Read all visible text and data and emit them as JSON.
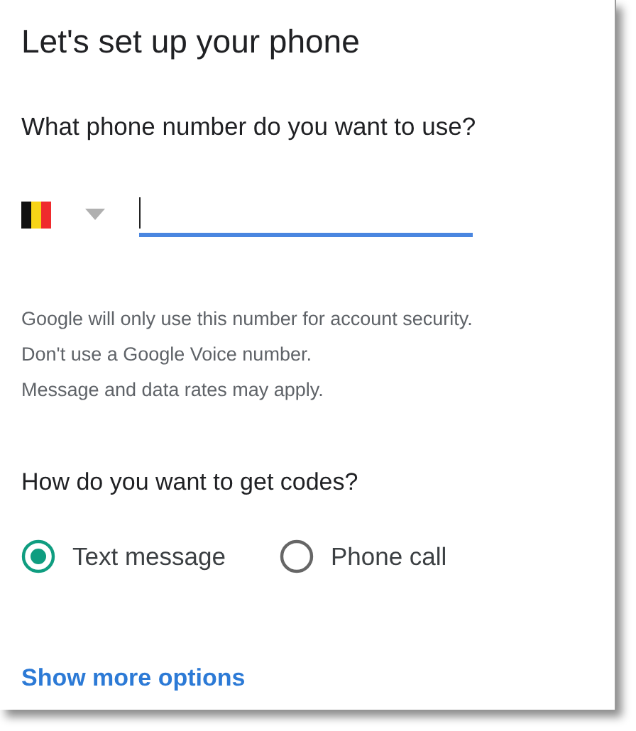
{
  "title": "Let's set up your phone",
  "phone_question": "What phone number do you want to use?",
  "phone_field": {
    "focused": true
  },
  "notes": [
    "Google will only use this number for account security.",
    "Don't use a Google Voice number.",
    "Message and data rates may apply."
  ],
  "codes_question": "How do you want to get codes?",
  "options": [
    {
      "label": "Text message",
      "selected": true
    },
    {
      "label": "Phone call",
      "selected": false
    }
  ],
  "more_link": "Show more options"
}
